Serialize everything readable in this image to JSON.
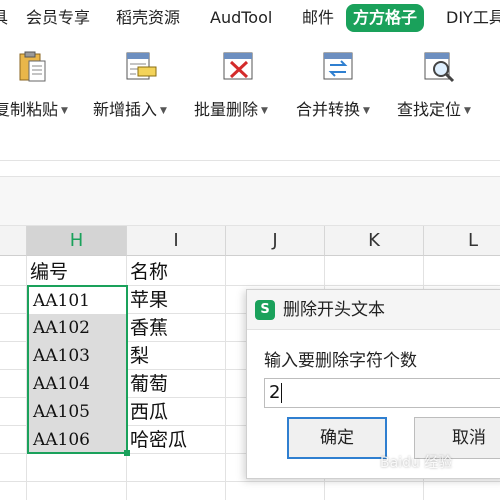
{
  "menu": {
    "tabs": [
      "具",
      "会员专享",
      "稻壳资源",
      "AudTool",
      "邮件",
      "方方格子",
      "DIY工具"
    ],
    "active_index": 5,
    "accent_color": "#1aa15b"
  },
  "ribbon": {
    "tools": [
      {
        "label": "复制粘贴",
        "icon": "paste-icon"
      },
      {
        "label": "新增插入",
        "icon": "insert-icon"
      },
      {
        "label": "批量删除",
        "icon": "batch-delete-icon"
      },
      {
        "label": "合并转换",
        "icon": "merge-convert-icon"
      },
      {
        "label": "查找定位",
        "icon": "find-locate-icon"
      }
    ]
  },
  "sheet": {
    "columns": [
      "H",
      "I",
      "J",
      "K",
      "L"
    ],
    "selected_column": "H",
    "rows": [
      [
        "编号",
        "名称"
      ],
      [
        "AA101",
        "苹果"
      ],
      [
        "AA102",
        "香蕉"
      ],
      [
        "AA103",
        "梨"
      ],
      [
        "AA104",
        "葡萄"
      ],
      [
        "AA105",
        "西瓜"
      ],
      [
        "AA106",
        "哈密瓜"
      ]
    ]
  },
  "dialog": {
    "title": "删除开头文本",
    "prompt": "输入要删除字符个数",
    "input_value": "2",
    "ok_label": "确定",
    "cancel_label": "取消"
  },
  "watermark": "Baidu 经验"
}
